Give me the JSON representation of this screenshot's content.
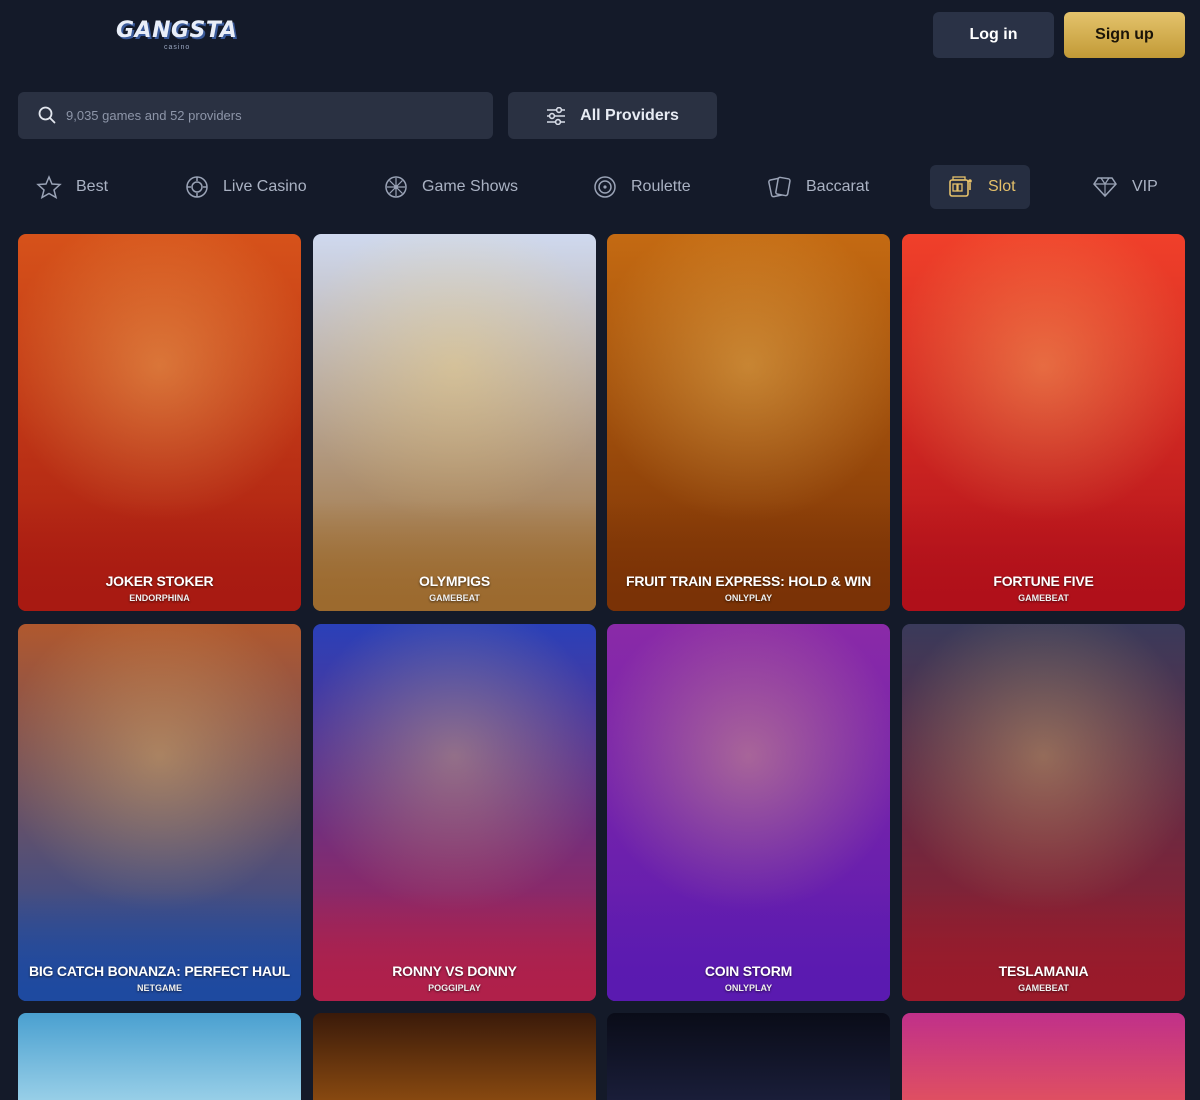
{
  "header": {
    "logo_text": "GANGSTA",
    "logo_subtext": "casino",
    "login_label": "Log in",
    "signup_label": "Sign up"
  },
  "search": {
    "placeholder": "9,035 games and 52 providers"
  },
  "providers_button": {
    "label": "All Providers"
  },
  "categories": [
    {
      "label": "Best",
      "icon": "star-icon"
    },
    {
      "label": "Live Casino",
      "icon": "chip-icon"
    },
    {
      "label": "Game Shows",
      "icon": "wheel-icon"
    },
    {
      "label": "Roulette",
      "icon": "roulette-icon"
    },
    {
      "label": "Baccarat",
      "icon": "cards-icon"
    },
    {
      "label": "Slot",
      "icon": "slot-machine-icon",
      "active": true
    },
    {
      "label": "VIP",
      "icon": "diamond-icon"
    }
  ],
  "games": [
    {
      "title": "JOKER STOKER",
      "provider": "ENDORPHINA",
      "colors": [
        "#d6521a",
        "#a81a12"
      ]
    },
    {
      "title": "OLYMPIGS",
      "provider": "GAMEBEAT",
      "colors": [
        "#cfd9ef",
        "#9c6a2e"
      ]
    },
    {
      "title": "FRUIT TRAIN EXPRESS: HOLD & WIN",
      "provider": "ONLYPLAY",
      "colors": [
        "#c46a12",
        "#7a3206"
      ]
    },
    {
      "title": "FORTUNE FIVE",
      "provider": "GAMEBEAT",
      "colors": [
        "#f0402a",
        "#b0101a"
      ]
    },
    {
      "title": "BIG CATCH BONANZA: PERFECT HAUL",
      "provider": "NETGAME",
      "colors": [
        "#b0582e",
        "#1e4aa0"
      ]
    },
    {
      "title": "RONNY VS DONNY",
      "provider": "POGGIPLAY",
      "colors": [
        "#2a40b8",
        "#b0204a"
      ]
    },
    {
      "title": "COIN STORM",
      "provider": "ONLYPLAY",
      "colors": [
        "#8a2aa8",
        "#5a1ab0"
      ]
    },
    {
      "title": "TESLAMANIA",
      "provider": "GAMEBEAT",
      "colors": [
        "#3a3a5a",
        "#9a1a2a"
      ]
    }
  ],
  "partial_games": [
    {
      "colors": [
        "#4aa0d0",
        "#9ad0e8"
      ]
    },
    {
      "colors": [
        "#3a1a0a",
        "#8a4a10"
      ]
    },
    {
      "colors": [
        "#0a0c18",
        "#1a1e3a"
      ]
    },
    {
      "colors": [
        "#c0308a",
        "#e05060"
      ]
    }
  ]
}
